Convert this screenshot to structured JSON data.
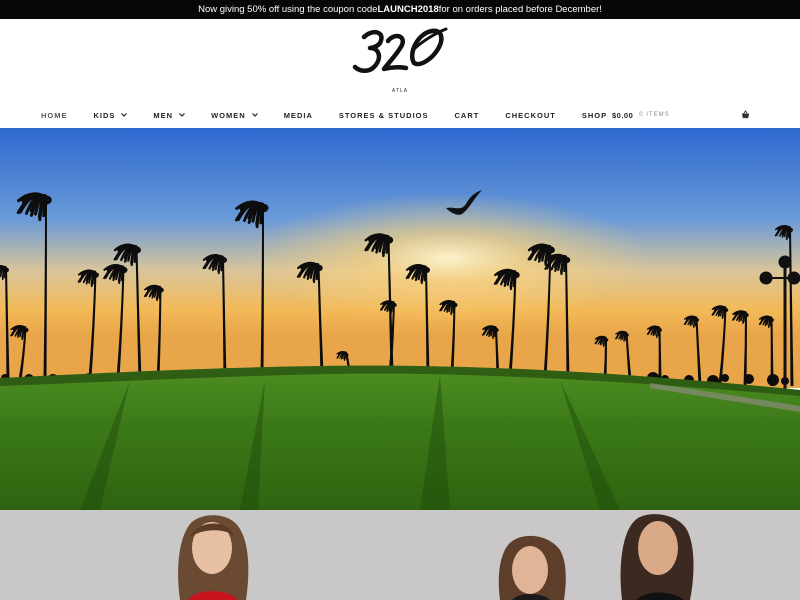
{
  "promo": {
    "prefix": "Now giving 50% off using the coupon code ",
    "code": "LAUNCH2018",
    "suffix": " for on orders placed before December!"
  },
  "brand": {
    "logo_text": "320",
    "sub": "ATLA"
  },
  "nav": {
    "items": [
      {
        "label": "HOME",
        "dropdown": false
      },
      {
        "label": "KIDS",
        "dropdown": true
      },
      {
        "label": "MEN",
        "dropdown": true
      },
      {
        "label": "WOMEN",
        "dropdown": true
      },
      {
        "label": "MEDIA",
        "dropdown": false
      },
      {
        "label": "STORES & STUDIOS",
        "dropdown": false
      },
      {
        "label": "CART",
        "dropdown": false
      },
      {
        "label": "CHECKOUT",
        "dropdown": false
      },
      {
        "label": "SHOP",
        "dropdown": false
      }
    ]
  },
  "cart": {
    "total": "$0.00",
    "items": "0 ITEMS",
    "icon": "basket-icon"
  },
  "hero": {
    "scene": "palm-trees-sunset-park"
  },
  "colors": {
    "promo_bg": "#070707",
    "header_bg": "#ffffff",
    "grass": "#3d7a1c",
    "sky_top": "#2f6fd0",
    "sunset": "#f6c15a"
  }
}
